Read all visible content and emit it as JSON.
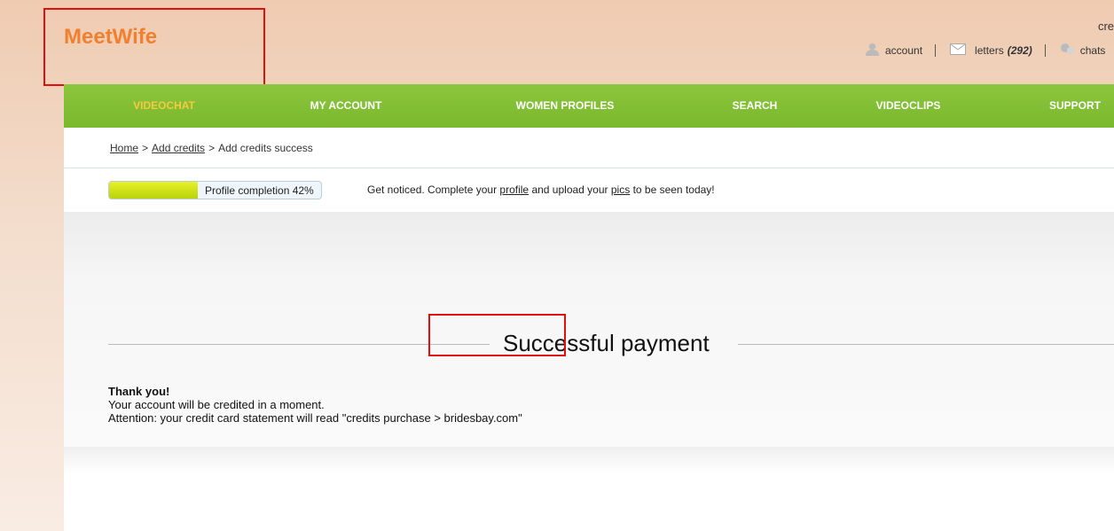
{
  "brand": {
    "name": "MeetWife"
  },
  "top_right": {
    "credits_partial": "cre",
    "account_label": "account",
    "letters_label": "letters",
    "letters_count": "(292)",
    "chats_label": "chats"
  },
  "nav": {
    "items": [
      "VIDEOCHAT",
      "MY ACCOUNT",
      "WOMEN PROFILES",
      "SEARCH",
      "VIDEOCLIPS",
      "SUPPORT"
    ],
    "active": "VIDEOCHAT",
    "active_color": "#f7c93e",
    "bar_color": "#7ab82c"
  },
  "breadcrumb": {
    "home": "Home",
    "add_credits": "Add credits",
    "current": "Add credits success",
    "separator": ">"
  },
  "profile_completion": {
    "label": "Profile completion 42%",
    "percent": 42
  },
  "notice": {
    "text1": "Get noticed. Complete your",
    "profile_link": "profile",
    "text2": "and upload your",
    "pics_link": "pics",
    "text3": "to be seen today!"
  },
  "payment": {
    "title": "Successful payment",
    "thanks": "Thank you!",
    "line1": "Your account will be credited in a moment.",
    "line2": "Attention: your credit card statement will read \"credits purchase > bridesbay.com\""
  },
  "colors": {
    "logo": "#f07f2e",
    "highlight_box": "#e01010"
  }
}
